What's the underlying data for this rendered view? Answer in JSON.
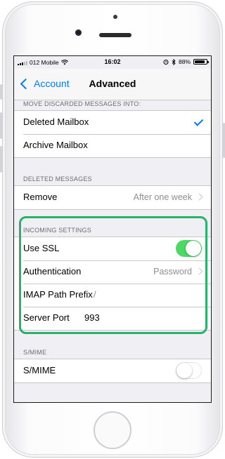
{
  "status_bar": {
    "carrier": "012 Mobile",
    "time": "16:02",
    "battery": "88%",
    "battery_level": 0.88
  },
  "nav": {
    "back_label": "Account",
    "title": "Advanced"
  },
  "sections": {
    "move_discarded": {
      "header": "MOVE DISCARDED MESSAGES INTO:",
      "options": [
        {
          "label": "Deleted Mailbox",
          "selected": true
        },
        {
          "label": "Archive Mailbox",
          "selected": false
        }
      ]
    },
    "deleted_messages": {
      "header": "DELETED MESSAGES",
      "remove_label": "Remove",
      "remove_value": "After one week"
    },
    "incoming_settings": {
      "header": "INCOMING SETTINGS",
      "use_ssl_label": "Use SSL",
      "use_ssl_on": true,
      "authentication_label": "Authentication",
      "authentication_value": "Password",
      "imap_prefix_label": "IMAP Path Prefix",
      "imap_prefix_value": "/",
      "server_port_label": "Server Port",
      "server_port_value": "993"
    },
    "smime": {
      "header": "S/MIME",
      "label": "S/MIME",
      "on": false
    }
  },
  "colors": {
    "accent": "#007aff",
    "toggle_on": "#4cd964",
    "highlight": "#27b36a"
  }
}
